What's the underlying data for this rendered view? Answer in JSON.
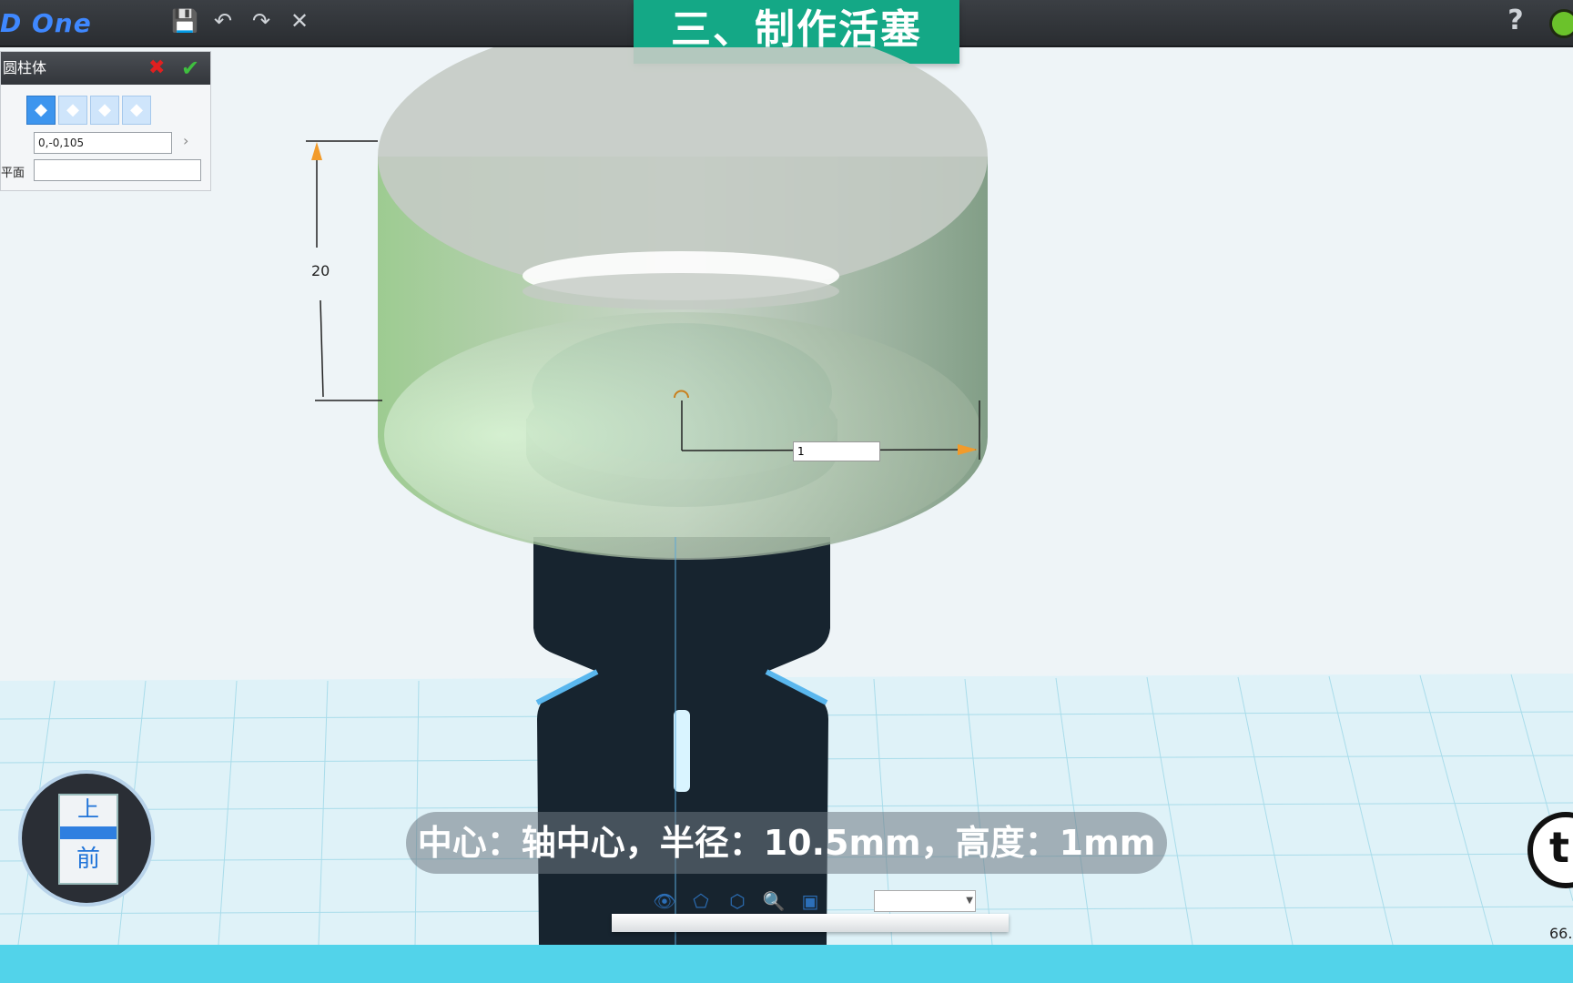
{
  "app": {
    "logo": "D One",
    "help": "?"
  },
  "toolbar": {
    "save": "save-icon",
    "undo": "undo-icon",
    "redo": "redo-icon",
    "close": "close-icon"
  },
  "banner": {
    "title": "三、制作活塞"
  },
  "panel": {
    "title": "圆柱体",
    "center_value": "0,-0,105",
    "plane_label": "平面",
    "plane_value": ""
  },
  "viewport": {
    "height_dimension": "20",
    "radius_input": "1"
  },
  "caption": {
    "text": "中心：轴中心，半径：10.5mm，高度：1mm"
  },
  "navcube": {
    "top": "上",
    "front": "前"
  },
  "status": {
    "zoom": "66."
  },
  "colors": {
    "banner": "#14a886",
    "accent": "#3d95ee",
    "ok": "#3fbf3f",
    "cancel": "#e02020"
  }
}
